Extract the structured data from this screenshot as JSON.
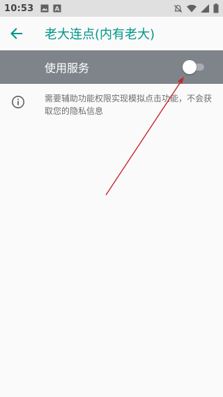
{
  "status_bar": {
    "time": "10:53",
    "icons_left": [
      "image-icon",
      "a-box-icon"
    ],
    "icons_right": [
      "do-not-disturb-icon",
      "wifi-icon",
      "signal-icon",
      "battery-icon"
    ]
  },
  "app_bar": {
    "title": "老大连点(内有老大)",
    "back_icon": "arrow-back-icon"
  },
  "service": {
    "label": "使用服务",
    "enabled": false
  },
  "info": {
    "icon": "info-icon",
    "text": "需要辅助功能权限实现模拟点击功能，不会获取您的隐私信息"
  },
  "colors": {
    "accent": "#009688",
    "service_row_bg": "#7f848b",
    "annotation_arrow": "#c62828"
  }
}
